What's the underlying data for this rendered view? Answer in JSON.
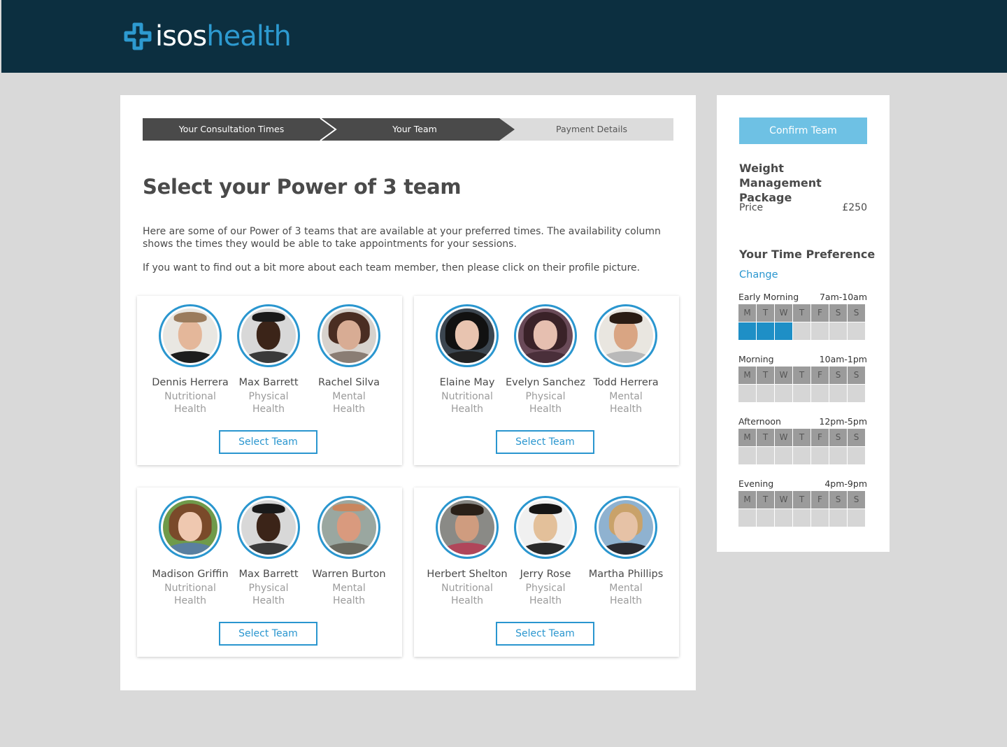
{
  "brand": {
    "part1": "isos",
    "part2": "health"
  },
  "steps": [
    "Your Consultation Times",
    "Your Team",
    "Payment Details"
  ],
  "title": "Select your Power of 3 team",
  "intro": [
    "Here are some of our Power of 3 teams that are available at your preferred times. The availability column shows the times they would be able to take appointments for your sessions.",
    "If you want to find out a bit more about each team member, then please click on their profile picture."
  ],
  "teams": [
    {
      "button": "Select Team",
      "members": [
        {
          "name": "Dennis Herrera",
          "role1": "Nutritional",
          "role2": "Health"
        },
        {
          "name": "Max Barrett",
          "role1": "Physical",
          "role2": "Health"
        },
        {
          "name": "Rachel Silva",
          "role1": "Mental",
          "role2": "Health"
        }
      ]
    },
    {
      "button": "Select Team",
      "members": [
        {
          "name": "Elaine May",
          "role1": "Nutritional",
          "role2": "Health"
        },
        {
          "name": "Evelyn Sanchez",
          "role1": "Physical",
          "role2": "Health"
        },
        {
          "name": "Todd Herrera",
          "role1": "Mental",
          "role2": "Health"
        }
      ]
    },
    {
      "button": "Select Team",
      "members": [
        {
          "name": "Madison Griffin",
          "role1": "Nutritional",
          "role2": "Health"
        },
        {
          "name": "Max Barrett",
          "role1": "Physical",
          "role2": "Health"
        },
        {
          "name": "Warren Burton",
          "role1": "Mental",
          "role2": "Health"
        }
      ]
    },
    {
      "button": "Select Team",
      "members": [
        {
          "name": "Herbert Shelton",
          "role1": "Nutritional",
          "role2": "Health"
        },
        {
          "name": "Jerry Rose",
          "role1": "Physical",
          "role2": "Health"
        },
        {
          "name": "Martha Phillips",
          "role1": "Mental",
          "role2": "Health"
        }
      ]
    }
  ],
  "sidebar": {
    "confirm": "Confirm Team",
    "package_title": "Weight Management Package",
    "price_label": "Price",
    "price_value": "£250",
    "pref_title": "Your Time Preference",
    "change": "Change",
    "days": [
      "M",
      "T",
      "W",
      "T",
      "F",
      "S",
      "S"
    ],
    "slots": [
      {
        "name": "Early Morning",
        "time": "7am-10am",
        "selected": [
          true,
          true,
          true,
          false,
          false,
          false,
          false
        ]
      },
      {
        "name": "Morning",
        "time": "10am-1pm",
        "selected": [
          false,
          false,
          false,
          false,
          false,
          false,
          false
        ]
      },
      {
        "name": "Afternoon",
        "time": "12pm-5pm",
        "selected": [
          false,
          false,
          false,
          false,
          false,
          false,
          false
        ]
      },
      {
        "name": "Evening",
        "time": "4pm-9pm",
        "selected": [
          false,
          false,
          false,
          false,
          false,
          false,
          false
        ]
      }
    ]
  },
  "colors": {
    "header": "#0c2f40",
    "accent": "#2a96cf",
    "confirm": "#6ec1e4",
    "background": "#d9d9d9"
  }
}
